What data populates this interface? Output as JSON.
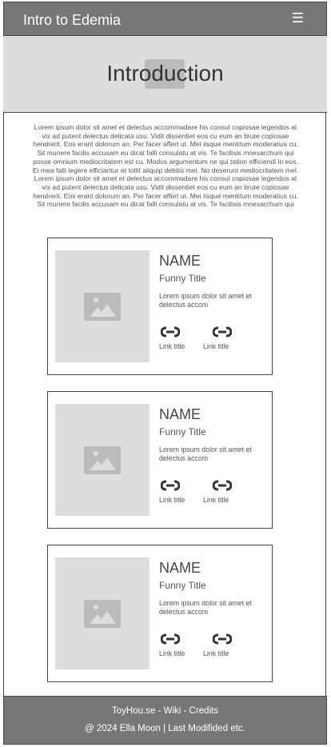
{
  "header": {
    "title": "Intro to Edemia",
    "menu_icon": "hamburger-icon",
    "menu_glyph": "☰"
  },
  "hero": {
    "title": "Introduction"
  },
  "intro_text": "Lorem ipsum dolor sit amet et delectus accommodare his consul copiosae legendos at vix ad putent delectus delicata usu. Vidit dissentiet eos cu eum an brute copiosae hendrerit. Eos erant dolorum an. Per facer affert ut. Mei iisque mentitum moderatius cu. Sit munere facilis accusam eu dicat falli consulatu at vis. Te facilisis mnesarchum qui posse omnium mediocritatem est cu. Modus argumentum ne qui tation efficiendi in eos. Ei mea falli legere efficiantur et tollit aliquip debitis mei. No deserunt mediocritatem mel. Lorem ipsum dolor sit amet et delectus accommodare his consul copiosae legendos at vix ad putent delectus delicata usu. Vidit dissentiet eos cu eum an brute copiosae hendrerit. Eos erant dolorum an. Per facer affert ut. Mei iisque mentitum moderatius cu. Sit munere facilis accusam eu dicat falli consulatu at vis. Te facilisis mnesarchum qui",
  "cards": [
    {
      "name": "NAME",
      "title": "Funny Title",
      "desc": "Lorem ipsum dolor sit amet et delectus accom",
      "links": [
        "Link title",
        "Link title"
      ]
    },
    {
      "name": "NAME",
      "title": "Funny Title",
      "desc": "Lorem ipsum dolor sit amet et delectus accom",
      "links": [
        "Link title",
        "Link title"
      ]
    },
    {
      "name": "NAME",
      "title": "Funny Title",
      "desc": "Lorem ipsum dolor sit amet et delectus accom",
      "links": [
        "Link title",
        "Link title"
      ]
    }
  ],
  "footer": {
    "line1": "ToyHou.se - Wiki - Credits",
    "line2": "@ 2024 Ella Moon | Last Modifided etc."
  },
  "colors": {
    "header_bg": "#777777",
    "hero_bg": "#dddddd",
    "placeholder": "#bbbbbb"
  }
}
